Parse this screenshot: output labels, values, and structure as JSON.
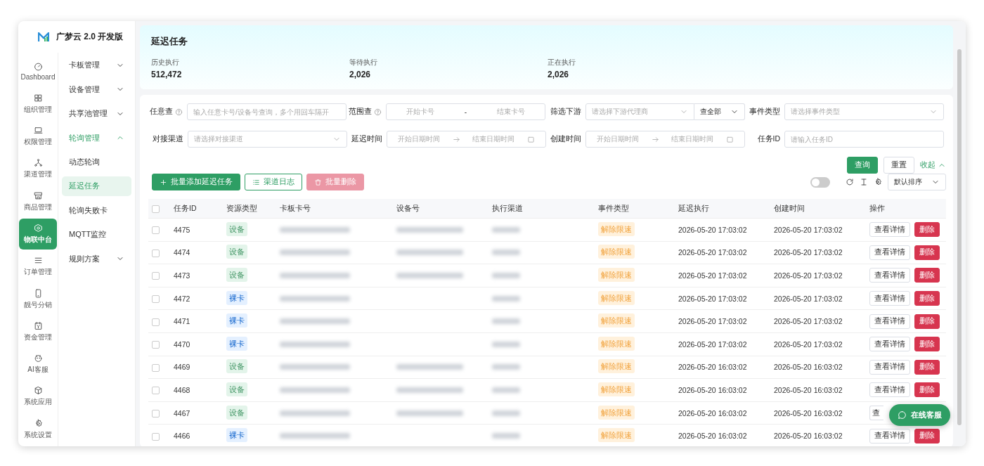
{
  "brand": {
    "name": "广梦云 2.0 开发版"
  },
  "rail": [
    {
      "label": "Dashboard",
      "selected": false
    },
    {
      "label": "组织管理",
      "selected": false
    },
    {
      "label": "权限管理",
      "selected": false
    },
    {
      "label": "渠道管理",
      "selected": false
    },
    {
      "label": "商品管理",
      "selected": false
    },
    {
      "label": "物联中台",
      "selected": true
    },
    {
      "label": "订单管理",
      "selected": false
    },
    {
      "label": "靓号分销",
      "selected": false
    },
    {
      "label": "资金管理",
      "selected": false
    },
    {
      "label": "AI客服",
      "selected": false
    },
    {
      "label": "系统应用",
      "selected": false
    },
    {
      "label": "系统设置",
      "selected": false
    }
  ],
  "submenu": [
    {
      "label": "卡板管理",
      "expanded": false
    },
    {
      "label": "设备管理",
      "expanded": false
    },
    {
      "label": "共享池管理",
      "expanded": false
    },
    {
      "label": "轮询管理",
      "expanded": true,
      "children": [
        {
          "label": "动态轮询",
          "selected": false
        },
        {
          "label": "延迟任务",
          "selected": true
        },
        {
          "label": "轮询失败卡",
          "selected": false
        },
        {
          "label": "MQTT监控",
          "selected": false
        }
      ]
    },
    {
      "label": "规则方案",
      "expanded": false
    }
  ],
  "header": {
    "title": "延迟任务",
    "stats": [
      {
        "label": "历史执行",
        "value": "512,472"
      },
      {
        "label": "等待执行",
        "value": "2,026"
      },
      {
        "label": "正在执行",
        "value": "2,026"
      }
    ]
  },
  "filters": [
    {
      "label": "任意查",
      "help": true,
      "kind": "text",
      "placeholder": "输入任意卡号/设备号查询，多个用回车隔开"
    },
    {
      "label": "范围查",
      "help": true,
      "kind": "range",
      "start_placeholder": "开始卡号",
      "separator": "-",
      "end_placeholder": "结束卡号"
    },
    {
      "label": "筛选下游",
      "kind": "select_pair",
      "placeholder": "请选择下游代理商",
      "value": "查全部"
    },
    {
      "label": "事件类型",
      "kind": "select",
      "placeholder": "请选择事件类型"
    },
    {
      "label": "对接渠道",
      "kind": "select",
      "placeholder": "请选择对接渠道"
    },
    {
      "label": "延迟时间",
      "kind": "daterange",
      "start_placeholder": "开始日期时间",
      "end_placeholder": "结束日期时间"
    },
    {
      "label": "创建时间",
      "kind": "daterange",
      "start_placeholder": "开始日期时间",
      "end_placeholder": "结束日期时间"
    },
    {
      "label": "任务ID",
      "kind": "text",
      "placeholder": "请输入任务ID"
    }
  ],
  "filter_actions": {
    "search": "查询",
    "reset": "重置",
    "collapse": "收起"
  },
  "toolbar": {
    "buttons": [
      {
        "label": "批量添加延迟任务",
        "kind": "primary"
      },
      {
        "label": "渠道日志",
        "kind": "outline"
      },
      {
        "label": "批量删除",
        "kind": "danger",
        "disabled": true
      }
    ],
    "toggle_on": false,
    "sort": "默认排序"
  },
  "table": {
    "columns": [
      "任务ID",
      "资源类型",
      "卡板卡号",
      "设备号",
      "执行渠道",
      "事件类型",
      "延迟执行",
      "创建时间",
      "操作"
    ],
    "header_checked": false,
    "rows": [
      {
        "checked": false,
        "id": "4475",
        "resource": "设备",
        "color": "#e3f4ea",
        "card_redacted": true,
        "device_redacted": true,
        "channel_redacted": true,
        "event": "解除限速",
        "delay": "2026-05-20 17:03:02",
        "created": "2026-05-20 17:03:02",
        "view": "查看详情",
        "delete": "删除"
      },
      {
        "checked": false,
        "id": "4474",
        "resource": "设备",
        "color": "#e3f4ea",
        "card_redacted": true,
        "device_redacted": true,
        "channel_redacted": true,
        "event": "解除限速",
        "delay": "2026-05-20 17:03:02",
        "created": "2026-05-20 17:03:02",
        "view": "查看详情",
        "delete": "删除"
      },
      {
        "checked": false,
        "id": "4473",
        "resource": "设备",
        "color": "#e3f4ea",
        "card_redacted": true,
        "device_redacted": true,
        "channel_redacted": true,
        "event": "解除限速",
        "delay": "2026-05-20 17:03:02",
        "created": "2026-05-20 17:03:02",
        "view": "查看详情",
        "delete": "删除"
      },
      {
        "checked": false,
        "id": "4472",
        "resource": "裸卡",
        "color": "#e4f0ff",
        "card_redacted": true,
        "device_redacted": false,
        "channel_redacted": true,
        "event": "解除限速",
        "delay": "2026-05-20 17:03:02",
        "created": "2026-05-20 17:03:02",
        "view": "查看详情",
        "delete": "删除"
      },
      {
        "checked": false,
        "id": "4471",
        "resource": "裸卡",
        "color": "#e4f0ff",
        "card_redacted": true,
        "device_redacted": false,
        "channel_redacted": true,
        "event": "解除限速",
        "delay": "2026-05-20 17:03:02",
        "created": "2026-05-20 17:03:02",
        "view": "查看详情",
        "delete": "删除"
      },
      {
        "checked": false,
        "id": "4470",
        "resource": "裸卡",
        "color": "#e4f0ff",
        "card_redacted": true,
        "device_redacted": false,
        "channel_redacted": true,
        "event": "解除限速",
        "delay": "2026-05-20 17:03:02",
        "created": "2026-05-20 17:03:02",
        "view": "查看详情",
        "delete": "删除"
      },
      {
        "checked": false,
        "id": "4469",
        "resource": "设备",
        "color": "#e3f4ea",
        "card_redacted": true,
        "device_redacted": true,
        "channel_redacted": true,
        "event": "解除限速",
        "delay": "2026-05-20 16:03:02",
        "created": "2026-05-20 16:03:02",
        "view": "查看详情",
        "delete": "删除"
      },
      {
        "checked": false,
        "id": "4468",
        "resource": "设备",
        "color": "#e3f4ea",
        "card_redacted": true,
        "device_redacted": true,
        "channel_redacted": true,
        "event": "解除限速",
        "delay": "2026-05-20 16:03:02",
        "created": "2026-05-20 16:03:02",
        "view": "查看详情",
        "delete": "删除"
      },
      {
        "checked": false,
        "id": "4467",
        "resource": "设备",
        "color": "#e3f4ea",
        "card_redacted": true,
        "device_redacted": true,
        "channel_redacted": true,
        "event": "解除限速",
        "delay": "2026-05-20 16:03:02",
        "created": "2026-05-20 16:03:02",
        "view": "查"
      },
      {
        "checked": false,
        "id": "4466",
        "resource": "裸卡",
        "color": "#e4f0ff",
        "card_redacted": true,
        "device_redacted": false,
        "channel_redacted": true,
        "event": "解除限速",
        "delay": "2026-05-20 16:03:02",
        "created": "2026-05-20 16:03:02",
        "view": "查看详情",
        "delete": "删除"
      }
    ]
  },
  "chat_button": {
    "label": "在线客服"
  }
}
